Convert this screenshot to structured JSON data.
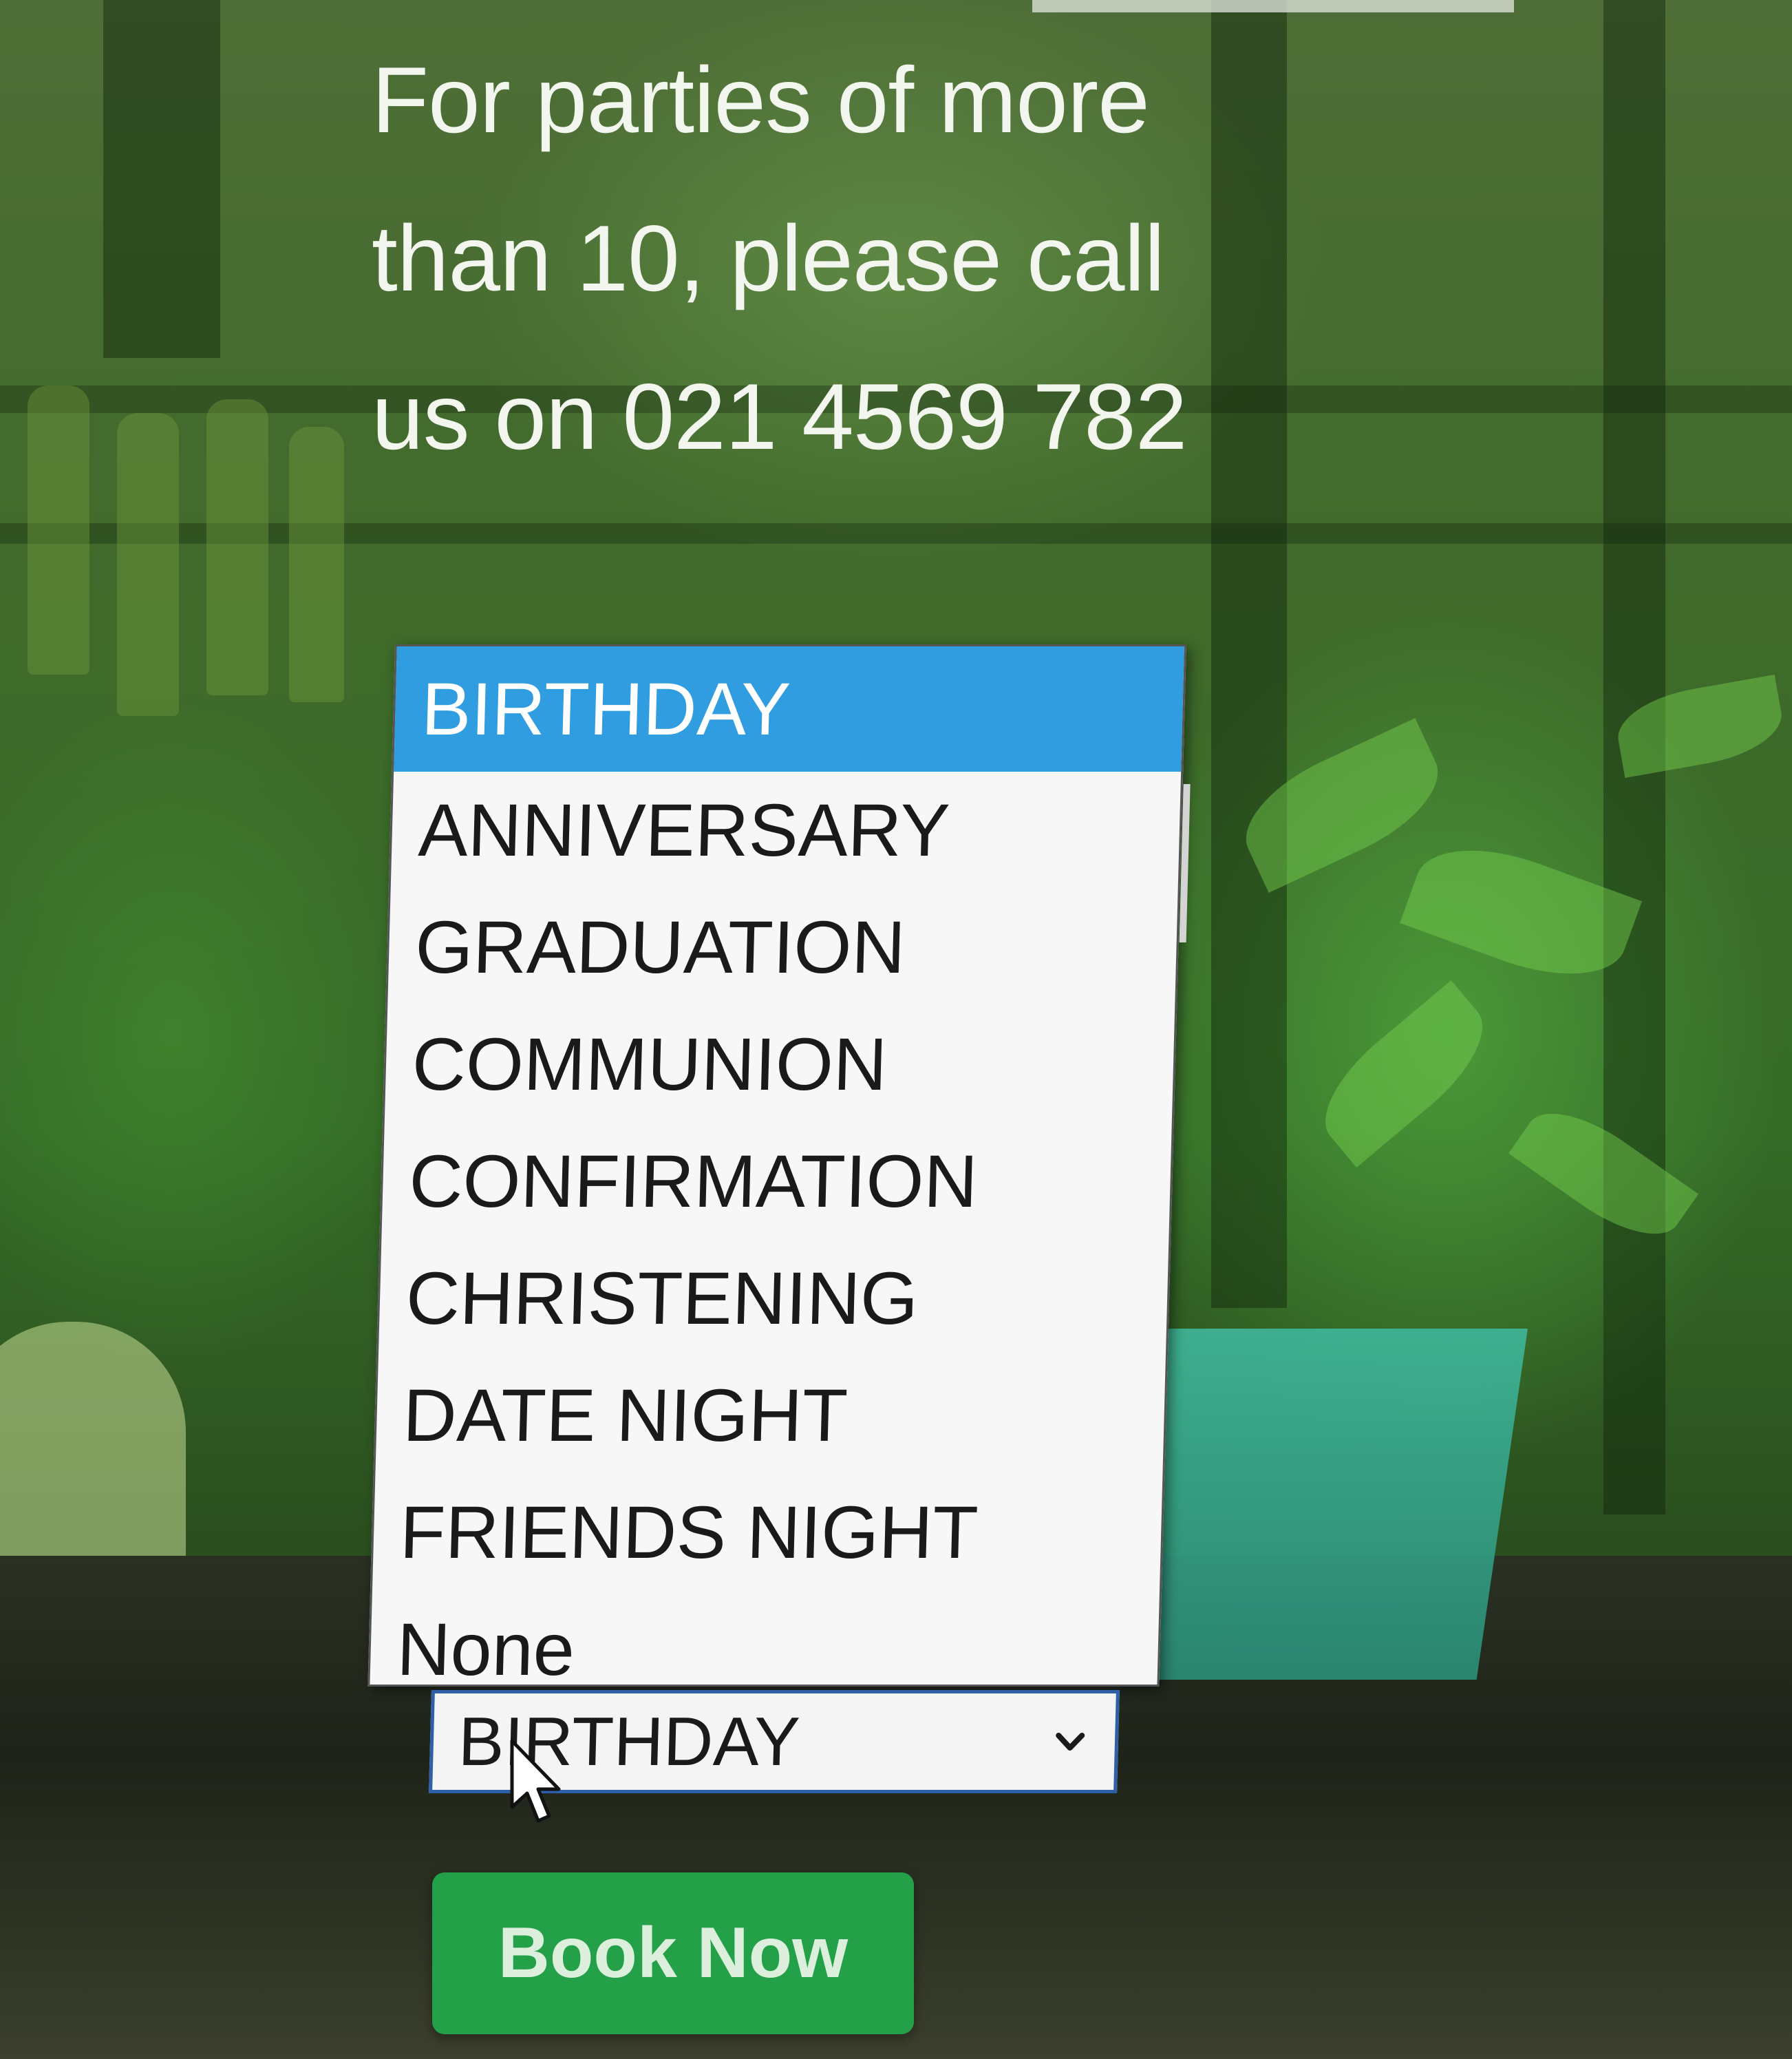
{
  "info_text": {
    "line1": "For parties of more",
    "line2": "than 10, please call",
    "line3": "us on 021 4569 782"
  },
  "occasion_select": {
    "selected_value": "BIRTHDAY",
    "options": [
      "BIRTHDAY",
      "ANNIVERSARY",
      "GRADUATION",
      "COMMUNION",
      "CONFIRMATION",
      "CHRISTENING",
      "DATE NIGHT",
      "FRIENDS NIGHT",
      "None"
    ],
    "highlighted_index": 0
  },
  "book_button": {
    "label": "Book Now"
  },
  "colors": {
    "highlight": "#2f9de0",
    "button": "#23a048",
    "select_border": "#2f5fa8"
  },
  "icons": {
    "select_chevron": "chevron-down-icon",
    "pointer": "mouse-cursor-icon"
  }
}
